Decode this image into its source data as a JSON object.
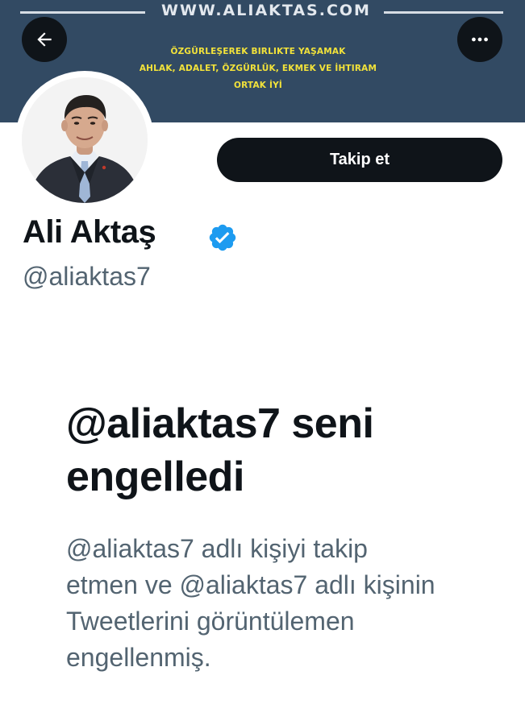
{
  "banner": {
    "url_text": "WWW.ALIAKTAS.COM",
    "slogan_line1": "ÖZGÜRLEŞEREK BIRLIKTE YAŞAMAK",
    "slogan_line2": "AHLAK, ADALET, ÖZGÜRLÜK, EKMEK VE İHTIRAM",
    "slogan_line3": "ORTAK İYİ",
    "background_color": "#324a63",
    "slogan_color": "#f2e23a"
  },
  "nav": {
    "back_icon": "arrow-left-icon",
    "more_icon": "more-horizontal-icon"
  },
  "profile": {
    "display_name": "Ali Aktaş",
    "handle": "@aliaktas7",
    "verified_icon": "verified-badge-icon",
    "verified_color": "#1d9bf0",
    "follow_label": "Takip et"
  },
  "blocked": {
    "title": "@aliaktas7 seni engelledi",
    "description": "@aliaktas7 adlı kişiyi takip etmen ve @aliaktas7 adlı kişinin Tweetlerini görüntülemen engellenmiş."
  }
}
